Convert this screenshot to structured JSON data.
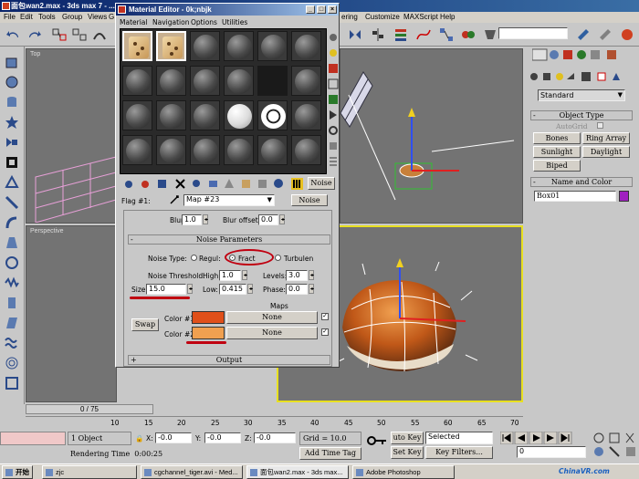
{
  "app": {
    "title": "面包wan2.max - 3ds max 7 - ..."
  },
  "menu": [
    "File",
    "Edit",
    "Tools",
    "Group",
    "Views",
    "G",
    "ering",
    "Customize",
    "MAXScript",
    "Help"
  ],
  "viewports": {
    "top_label": "Top",
    "perspective_label": "Perspective"
  },
  "cmd_panel": {
    "standard_select": "Standard",
    "object_type_header": "Object Type",
    "autogrid": "AutoGrid",
    "buttons": [
      "Bones",
      "Ring Array",
      "Sunlight",
      "Daylight",
      "Biped"
    ],
    "name_color_header": "Name and Color",
    "object_name": "Box01",
    "object_color": "#a020c0"
  },
  "material_editor": {
    "title": "Material Editor - 0k;nbjk",
    "menu": [
      "Material",
      "Navigation",
      "Options",
      "Utilities"
    ],
    "flag_label": "Flag #1:",
    "map_name": "Map #23",
    "map_type": "Noise",
    "blur_label": "Blur:",
    "blur_value": "1.0",
    "blur_offset_label": "Blur offset:",
    "blur_offset_value": "0.0",
    "noise_header": "Noise Parameters",
    "noise_type_label": "Noise Type:",
    "noise_regular": "Regul:",
    "noise_fractal": "Fract",
    "noise_turbulence": "Turbulen",
    "noise_threshold_label": "Noise Threshold:",
    "high_label": "High:",
    "high_value": "1.0",
    "levels_label": "Levels:",
    "levels_value": "3.0",
    "size_label": "Size",
    "size_value": "15.0",
    "low_label": "Low:",
    "low_value": "0.415",
    "phase_label": "Phase:",
    "phase_value": "0.0",
    "maps_label": "Maps",
    "color1_label": "Color #1",
    "color1": "#e0501a",
    "color1_map": "None",
    "color2_label": "Color #2",
    "color2": "#f0a050",
    "color2_map": "None",
    "swap_label": "Swap",
    "output_header": "Output",
    "plus": "+",
    "minus": "-"
  },
  "timeline": {
    "frame_counter": "0 / 75",
    "ticks": [
      "10",
      "15",
      "20",
      "25",
      "30",
      "35",
      "40",
      "45",
      "50",
      "55",
      "60",
      "65",
      "70"
    ]
  },
  "status": {
    "selection": "1 Object",
    "x_label": "X:",
    "x_value": "-0.0",
    "y_label": "Y:",
    "y_value": "-0.0",
    "z_label": "Z:",
    "z_value": "-0.0",
    "grid": "Grid = 10.0",
    "auto_key": "uto Key",
    "selected": "Selected",
    "set_key": "Set Key",
    "key_filters": "Key Filters...",
    "frame_field": "0",
    "rendering_time": "Rendering Time  0:00:25",
    "add_time_tag": "Add Time Tag"
  },
  "taskbar": {
    "start": "开始",
    "items": [
      "zjc",
      "cgchannel_tiger.avi - Med...",
      "面包wan2.max - 3ds max...",
      "Adobe Photoshop"
    ],
    "clock": "ChinaVR.com"
  }
}
